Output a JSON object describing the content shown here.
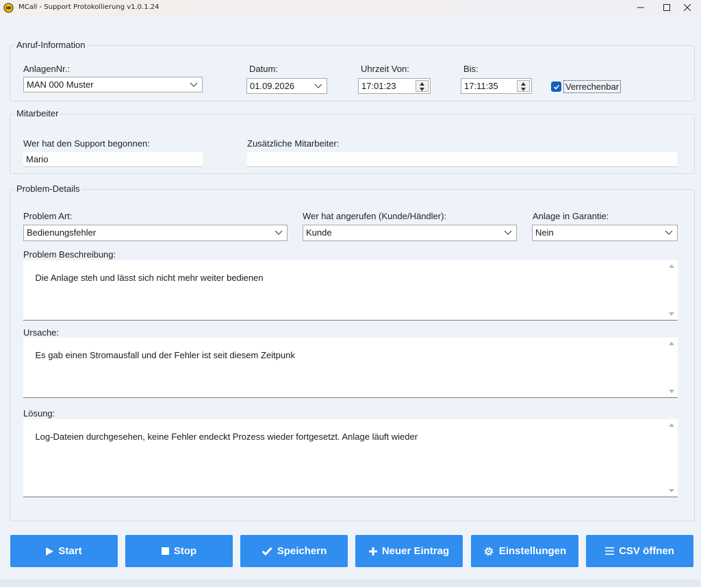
{
  "window": {
    "title": "MCall - Support Protokollierung  v1.0.1.24",
    "minimize_icon": "minimize-icon",
    "maximize_icon": "maximize-icon",
    "close_icon": "close-icon"
  },
  "call_info": {
    "legend": "Anruf-Information",
    "anlagen_label": "AnlagenNr.:",
    "anlagen_value": "MAN 000 Muster",
    "datum_label": "Datum:",
    "datum_value": "01.09.2026",
    "uhrzeit_von_label": "Uhrzeit Von:",
    "uhrzeit_von_value": "17:01:23",
    "bis_label": "Bis:",
    "bis_value": "17:11:35",
    "verrechenbar_label": "Verrechenbar",
    "verrechenbar_checked": true
  },
  "staff": {
    "legend": "Mitarbeiter",
    "started_label": "Wer hat den Support begonnen:",
    "started_value": "Mario",
    "additional_label": "Zusätzliche Mitarbeiter:",
    "additional_value": ""
  },
  "problem": {
    "legend": "Problem-Details",
    "art_label": "Problem Art:",
    "art_value": "Bedienungsfehler",
    "caller_label": "Wer hat angerufen (Kunde/Händler):",
    "caller_value": "Kunde",
    "warranty_label": "Anlage in Garantie:",
    "warranty_value": "Nein",
    "description_label": "Problem Beschreibung:",
    "description_value": "Die Anlage steh und lässt sich nicht mehr weiter bedienen",
    "cause_label": "Ursache:",
    "cause_value": "Es gab einen Stromausfall und der Fehler ist seit diesem Zeitpunk",
    "solution_label": "Lösung:",
    "solution_value": "Log-Dateien durchgesehen, keine Fehler endeckt Prozess wieder fortgesetzt. Anlage läuft wieder"
  },
  "buttons": {
    "start": "Start",
    "stop": "Stop",
    "save": "Speichern",
    "new_entry": "Neuer Eintrag",
    "settings": "Einstellungen",
    "open_csv": "CSV öffnen"
  },
  "colors": {
    "accent_button": "#2f8ef0",
    "checkbox": "#1461b8",
    "background": "#eef3f9"
  }
}
